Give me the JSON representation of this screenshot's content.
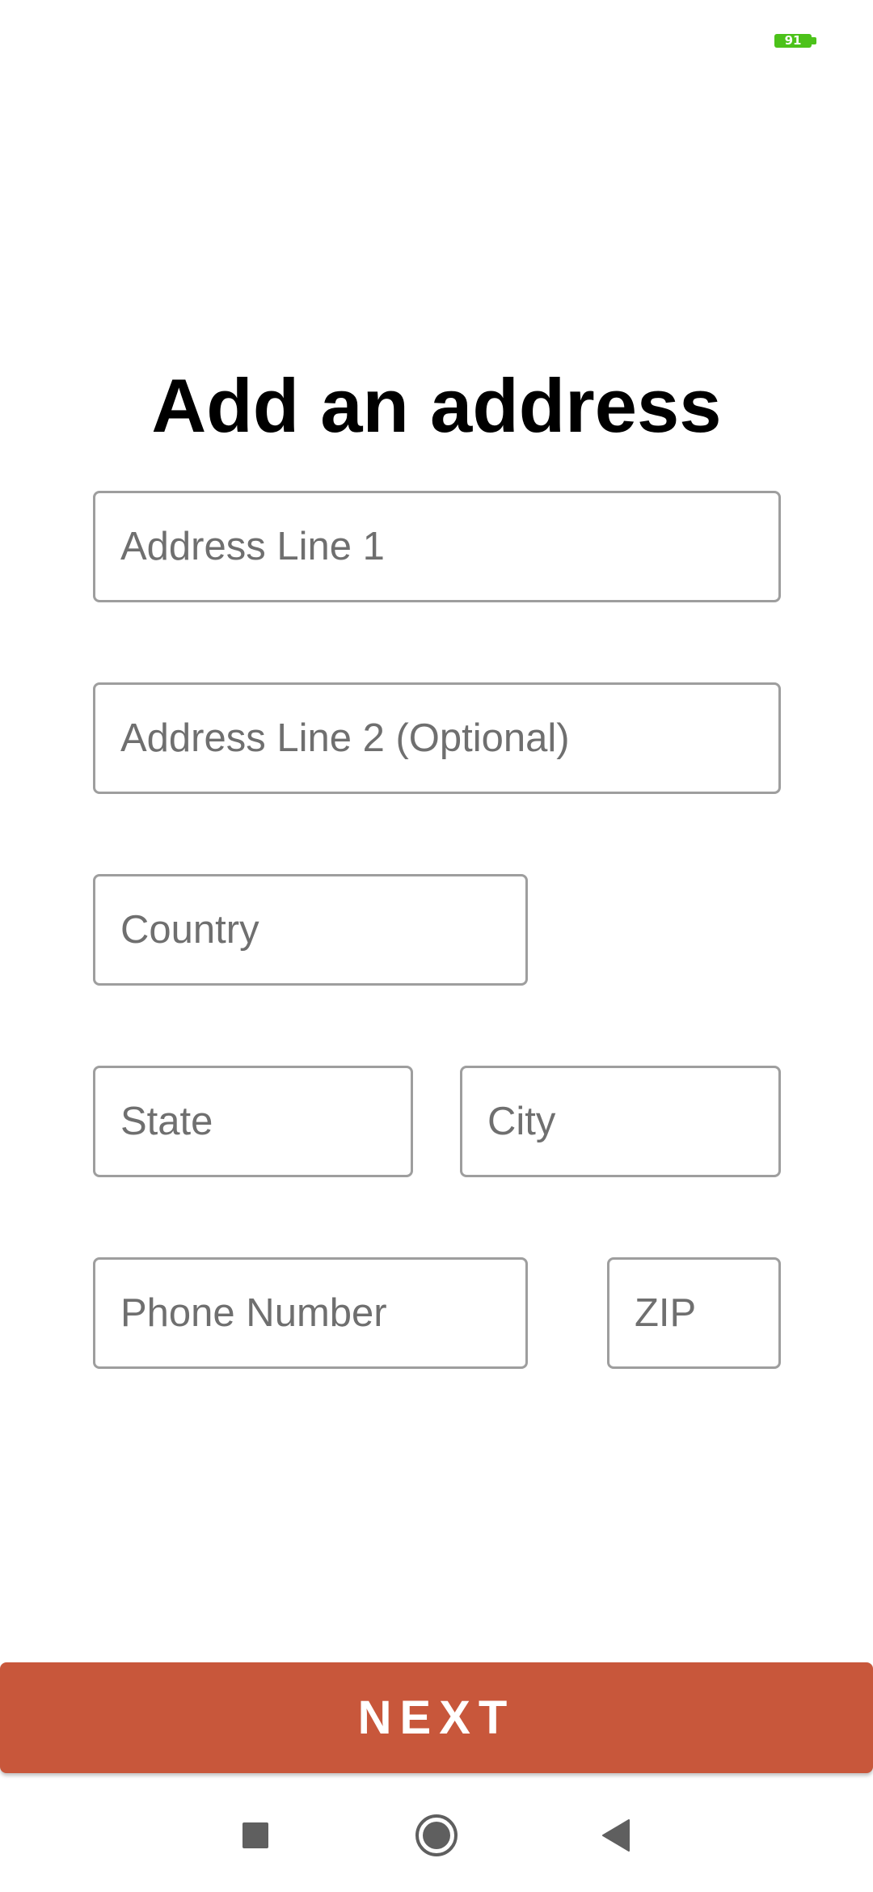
{
  "status_bar": {
    "battery_level": "91",
    "battery_color": "#4cc21a"
  },
  "title": "Add an address",
  "form": {
    "address_line_1": {
      "placeholder": "Address Line 1",
      "value": ""
    },
    "address_line_2": {
      "placeholder": "Address Line 2 (Optional)",
      "value": ""
    },
    "country": {
      "placeholder": "Country",
      "value": ""
    },
    "state": {
      "placeholder": "State",
      "value": ""
    },
    "city": {
      "placeholder": "City",
      "value": ""
    },
    "phone_number": {
      "placeholder": "Phone Number",
      "value": ""
    },
    "zip": {
      "placeholder": "ZIP",
      "value": ""
    }
  },
  "next_button": {
    "label": "NEXT",
    "color": "#c8573b"
  },
  "nav_bar": {
    "recents_icon": "square-icon",
    "home_icon": "circle-icon",
    "back_icon": "triangle-back-icon"
  }
}
